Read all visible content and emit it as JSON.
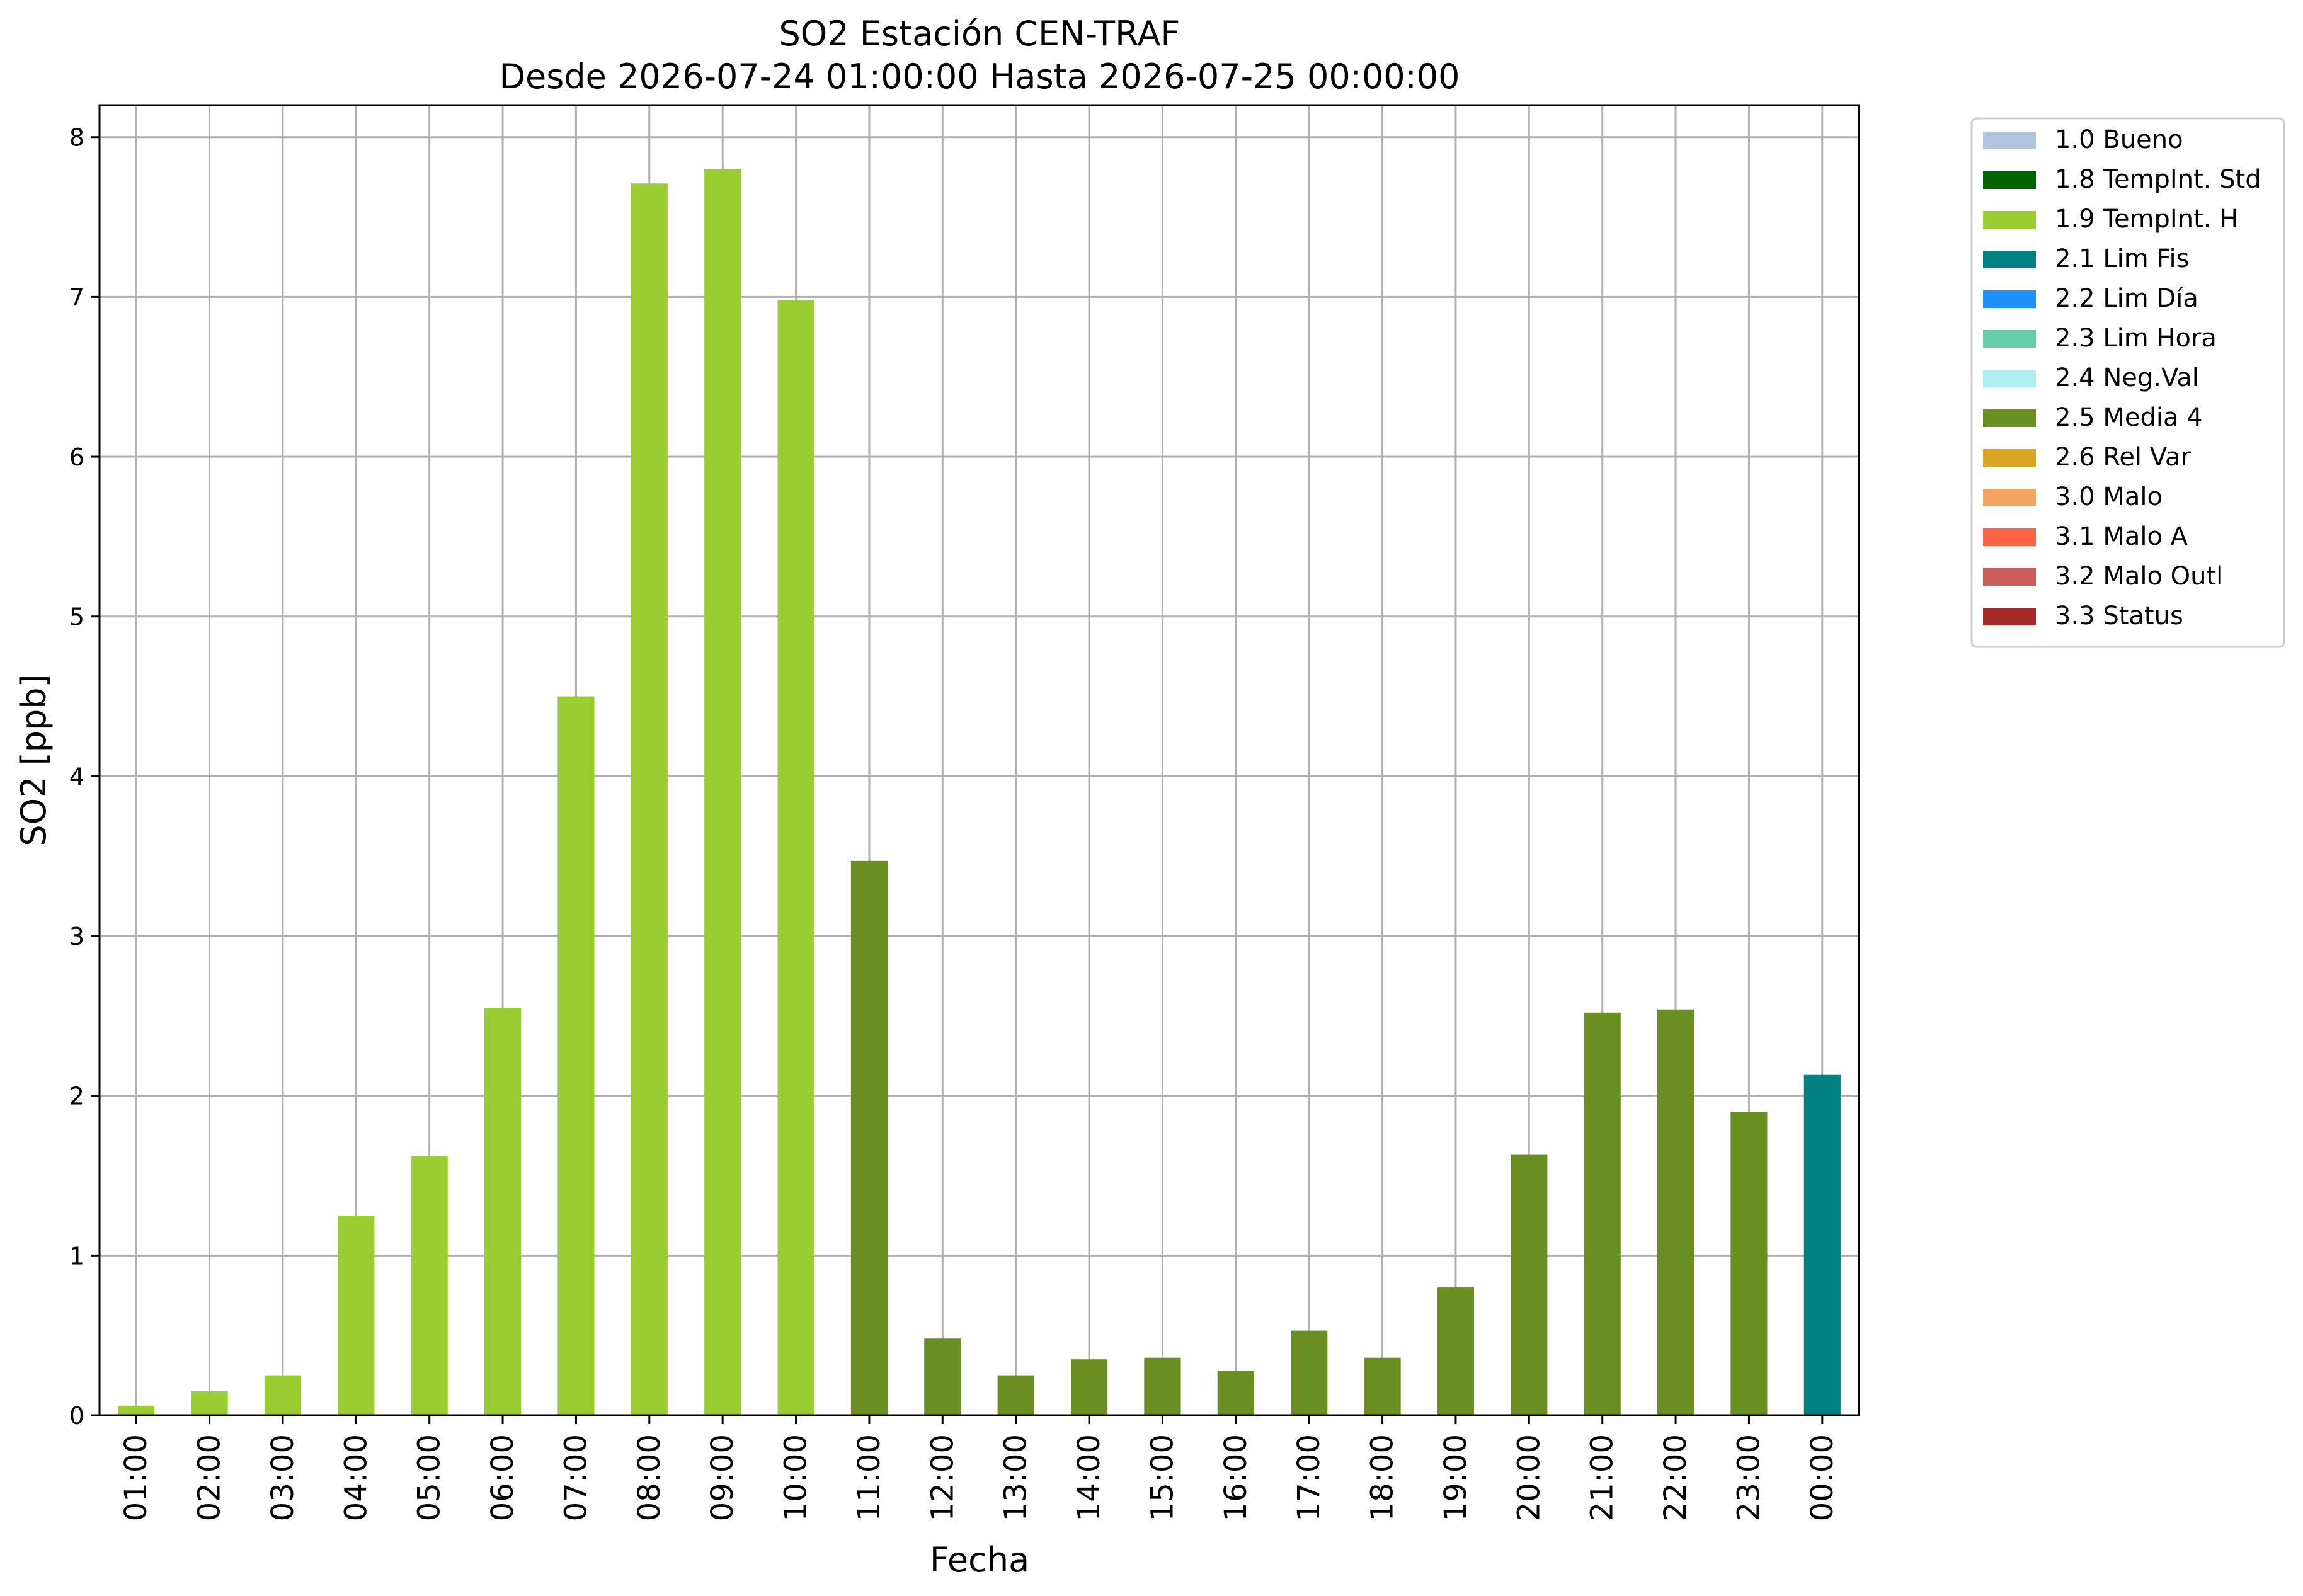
{
  "chart_data": {
    "type": "bar",
    "title": "SO2 Estación CEN-TRAF",
    "subtitle": "Desde 2026-07-24 01:00:00 Hasta 2026-07-25 00:00:00",
    "xlabel": "Fecha",
    "ylabel": "SO2 [ppb]",
    "ylim": [
      0,
      8.2
    ],
    "yticks": [
      0,
      1,
      2,
      3,
      4,
      5,
      6,
      7,
      8
    ],
    "grid": true,
    "legend_position": "outside-top-right",
    "categories": [
      "01:00",
      "02:00",
      "03:00",
      "04:00",
      "05:00",
      "06:00",
      "07:00",
      "08:00",
      "09:00",
      "10:00",
      "11:00",
      "12:00",
      "13:00",
      "14:00",
      "15:00",
      "16:00",
      "17:00",
      "18:00",
      "19:00",
      "20:00",
      "21:00",
      "22:00",
      "23:00",
      "00:00"
    ],
    "values": [
      0.06,
      0.15,
      0.25,
      1.25,
      1.62,
      2.55,
      4.5,
      7.71,
      7.8,
      6.98,
      3.47,
      0.48,
      0.25,
      0.35,
      0.36,
      0.28,
      0.53,
      0.36,
      0.8,
      1.63,
      2.52,
      2.54,
      1.9,
      2.13
    ],
    "flags": [
      "1.9 TempInt. H",
      "1.9 TempInt. H",
      "1.9 TempInt. H",
      "1.9 TempInt. H",
      "1.9 TempInt. H",
      "1.9 TempInt. H",
      "1.9 TempInt. H",
      "1.9 TempInt. H",
      "1.9 TempInt. H",
      "1.9 TempInt. H",
      "2.5 Media 4",
      "2.5 Media 4",
      "2.5 Media 4",
      "2.5 Media 4",
      "2.5 Media 4",
      "2.5 Media 4",
      "2.5 Media 4",
      "2.5 Media 4",
      "2.5 Media 4",
      "2.5 Media 4",
      "2.5 Media 4",
      "2.5 Media 4",
      "2.5 Media 4",
      "2.1 Lim Fis"
    ],
    "legend": [
      {
        "label": "1.0 Bueno",
        "color": "#b0c4de"
      },
      {
        "label": "1.8 TempInt. Std",
        "color": "#006400"
      },
      {
        "label": "1.9 TempInt. H",
        "color": "#9acd32"
      },
      {
        "label": "2.1 Lim Fis",
        "color": "#008080"
      },
      {
        "label": "2.2 Lim Día",
        "color": "#1e90ff"
      },
      {
        "label": "2.3 Lim Hora",
        "color": "#66cdaa"
      },
      {
        "label": "2.4 Neg.Val",
        "color": "#afeeee"
      },
      {
        "label": "2.5 Media 4",
        "color": "#6b8e23"
      },
      {
        "label": "2.6 Rel Var",
        "color": "#daa520"
      },
      {
        "label": "3.0 Malo",
        "color": "#f4a460"
      },
      {
        "label": "3.1 Malo A",
        "color": "#ff6347"
      },
      {
        "label": "3.2 Malo Outl",
        "color": "#cd5c5c"
      },
      {
        "label": "3.3 Status",
        "color": "#a52a2a"
      }
    ]
  }
}
